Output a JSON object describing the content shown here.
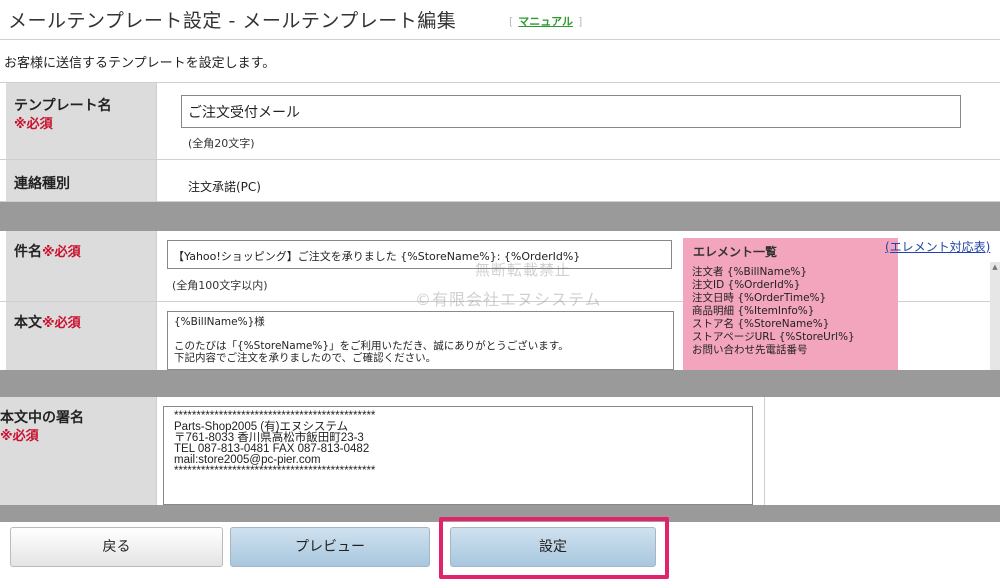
{
  "header": {
    "title": "メールテンプレート設定 - メールテンプレート編集",
    "manual_open": "[",
    "manual_link": "マニュアル",
    "manual_close": "]"
  },
  "description": "お客様に送信するテンプレートを設定します。",
  "form": {
    "template_name": {
      "label": "テンプレート名",
      "required": "※必須",
      "value": "ご注文受付メール",
      "hint": "(全角20文字)"
    },
    "contact_type": {
      "label": "連絡種別",
      "value": "注文承諾(PC)"
    },
    "subject": {
      "label": "件名",
      "required": "※必須",
      "value": "【Yahoo!ショッピング】ご注文を承りました {%StoreName%}: {%OrderId%}",
      "hint": "(全角100文字以内)"
    },
    "body": {
      "label": "本文",
      "required": "※必須",
      "value": "{%BillName%}様\n\nこのたびは「{%StoreName%}」をご利用いただき、誠にありがとうございます。\n下記内容でご注文を承りましたので、ご確認ください。"
    },
    "signature": {
      "label": "本文中の署名",
      "required": "※必須",
      "value": "*********************************************\nParts-Shop2005 (有)エヌシステム\n〒761-8033 香川県高松市飯田町23-3\nTEL 087-813-0481 FAX 087-813-0482\nmail:store2005@pc-pier.com\n*********************************************"
    }
  },
  "element_panel": {
    "title": "エレメント一覧",
    "table_link": "(エレメント対応表)",
    "items": [
      "注文者 {%BillName%}",
      "注文ID {%OrderId%}",
      "注文日時 {%OrderTime%}",
      "商品明細 {%ItemInfo%}",
      "ストア名 {%StoreName%}",
      "ストアページURL {%StoreUrl%}",
      "お問い合わせ先電話番号"
    ]
  },
  "watermark": {
    "line1": "無断転載禁止",
    "line2": "©有限会社エヌシステム"
  },
  "buttons": {
    "back": "戻る",
    "preview": "プレビュー",
    "set": "設定"
  },
  "colors": {
    "required": "#c8102e",
    "highlight": "#e0236b",
    "element_panel": "#f2a5bc",
    "link_green": "#2d9a2d"
  }
}
